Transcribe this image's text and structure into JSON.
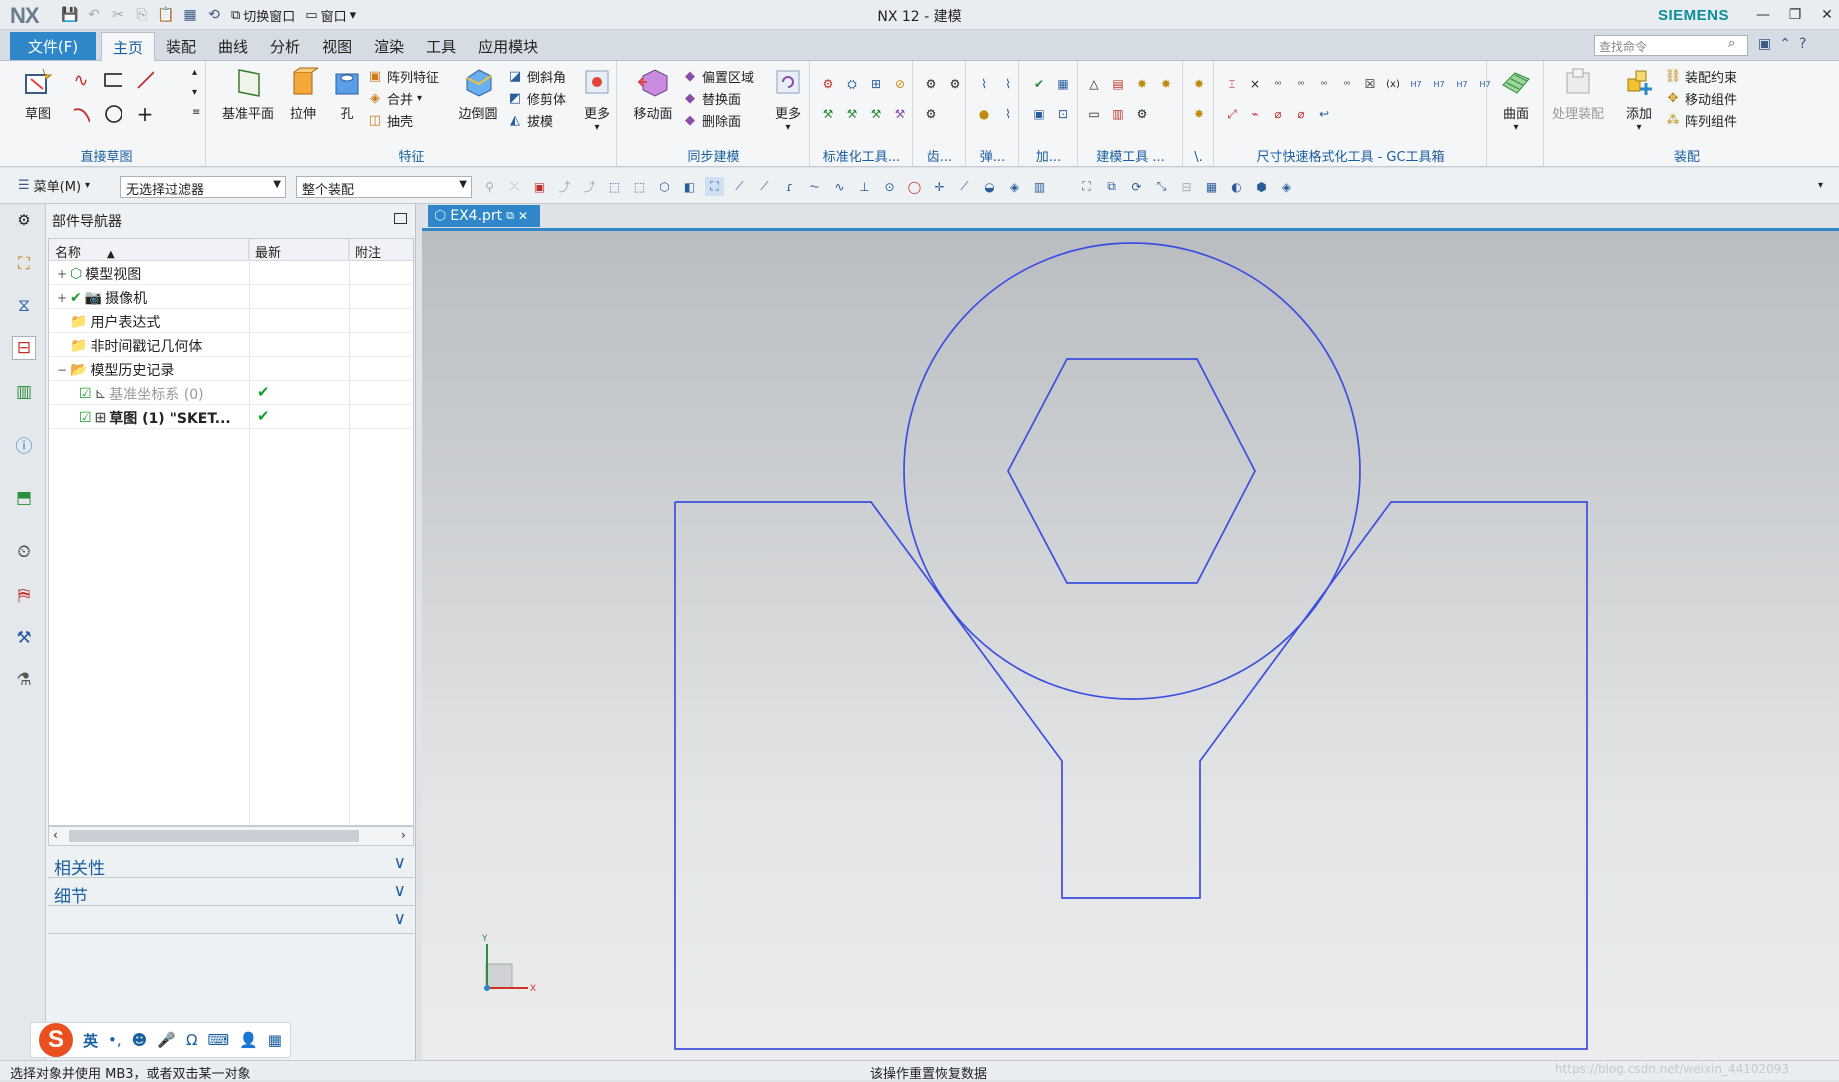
{
  "app": {
    "logo": "NX",
    "title": "NX 12 - 建模",
    "brand": "SIEMENS",
    "quick_access": {
      "switch_window": "切换窗口",
      "window_menu": "窗口"
    }
  },
  "menu_tabs": {
    "file": "文件(F)",
    "tabs": [
      "主页",
      "装配",
      "曲线",
      "分析",
      "视图",
      "渲染",
      "工具",
      "应用模块"
    ],
    "active": "主页",
    "search_placeholder": "查找命令"
  },
  "ribbon": {
    "sketch": {
      "label": "草图",
      "group": "直接草图"
    },
    "feature": {
      "datum_plane": "基准平面",
      "extrude": "拉伸",
      "hole": "孔",
      "pattern_feature": "阵列特征",
      "unite": "合并",
      "shell": "抽壳",
      "edge_blend": "边倒圆",
      "chamfer": "倒斜角",
      "trim_body": "修剪体",
      "draft": "拔模",
      "more": "更多",
      "group": "特征"
    },
    "sync": {
      "move_face": "移动面",
      "offset_region": "偏置区域",
      "replace_face": "替换面",
      "delete_face": "删除面",
      "more": "更多",
      "group": "同步建模"
    },
    "std_tools": "标准化工具...",
    "gear": "齿...",
    "spring": "弹...",
    "machining": "加...",
    "modeling_tools": "建模工具 ...",
    "extra": "\\.",
    "gc_toolkit": "尺寸快速格式化工具 - GC工具箱",
    "surface": "曲面",
    "assembly": {
      "process": "处理装配",
      "add": "添加",
      "constraint": "装配约束",
      "move_component": "移动组件",
      "pattern_component": "阵列组件",
      "group": "装配"
    }
  },
  "toolbar2": {
    "menu": "菜单(M)",
    "filter": "无选择过滤器",
    "scope": "整个装配"
  },
  "navigator": {
    "title": "部件导航器",
    "columns": [
      "名称",
      "最新",
      "附注"
    ],
    "rows": [
      {
        "name": "模型视图",
        "expander": "+",
        "latest": ""
      },
      {
        "name": "摄像机",
        "expander": "+",
        "latest": ""
      },
      {
        "name": "用户表达式",
        "expander": "",
        "latest": ""
      },
      {
        "name": "非时间戳记几何体",
        "expander": "",
        "latest": ""
      },
      {
        "name": "模型历史记录",
        "expander": "−",
        "latest": ""
      },
      {
        "name": "基准坐标系 (0)",
        "expander": "",
        "latest": "✔"
      },
      {
        "name": "草图 (1) \"SKET...",
        "expander": "",
        "latest": "✔"
      }
    ],
    "panels": [
      "相关性",
      "细节",
      ""
    ]
  },
  "document": {
    "tab": "EX4.prt"
  },
  "triad": {
    "x": "X",
    "y": "Y"
  },
  "status": {
    "left": "选择对象并使用 MB3，或者双击某一对象",
    "center": "该操作重置恢复数据"
  },
  "ime": {
    "lang": "英"
  },
  "watermark": "https://blog.csdn.net/weixin_44102093",
  "colors": {
    "accent": "#2f87c9",
    "sketch": "#3c4fe0",
    "check": "#1e9b2e",
    "brand": "#0a8f9a"
  }
}
